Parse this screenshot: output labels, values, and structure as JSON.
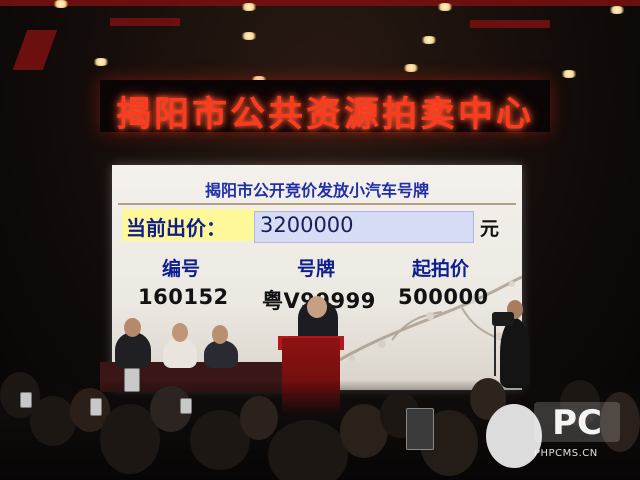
{
  "sign": {
    "text": "揭阳市公共资源拍卖中心"
  },
  "screen": {
    "title": "揭阳市公开竞价发放小汽车号牌",
    "price_label": "当前出价：",
    "price_value": "3200000",
    "price_unit": "元",
    "columns": [
      {
        "header": "编号",
        "value": "160152"
      },
      {
        "header": "号牌",
        "value": "粤V99999"
      },
      {
        "header": "起拍价",
        "value": "500000"
      }
    ]
  },
  "watermark": {
    "logo_text": "PC",
    "site": "PHPCMS.CN"
  },
  "colors": {
    "led_red": "#ff3a1e",
    "screen_blue_text": "#0e1e8f",
    "highlight_yellow": "#fff89a",
    "podium_red": "#8d1212"
  }
}
